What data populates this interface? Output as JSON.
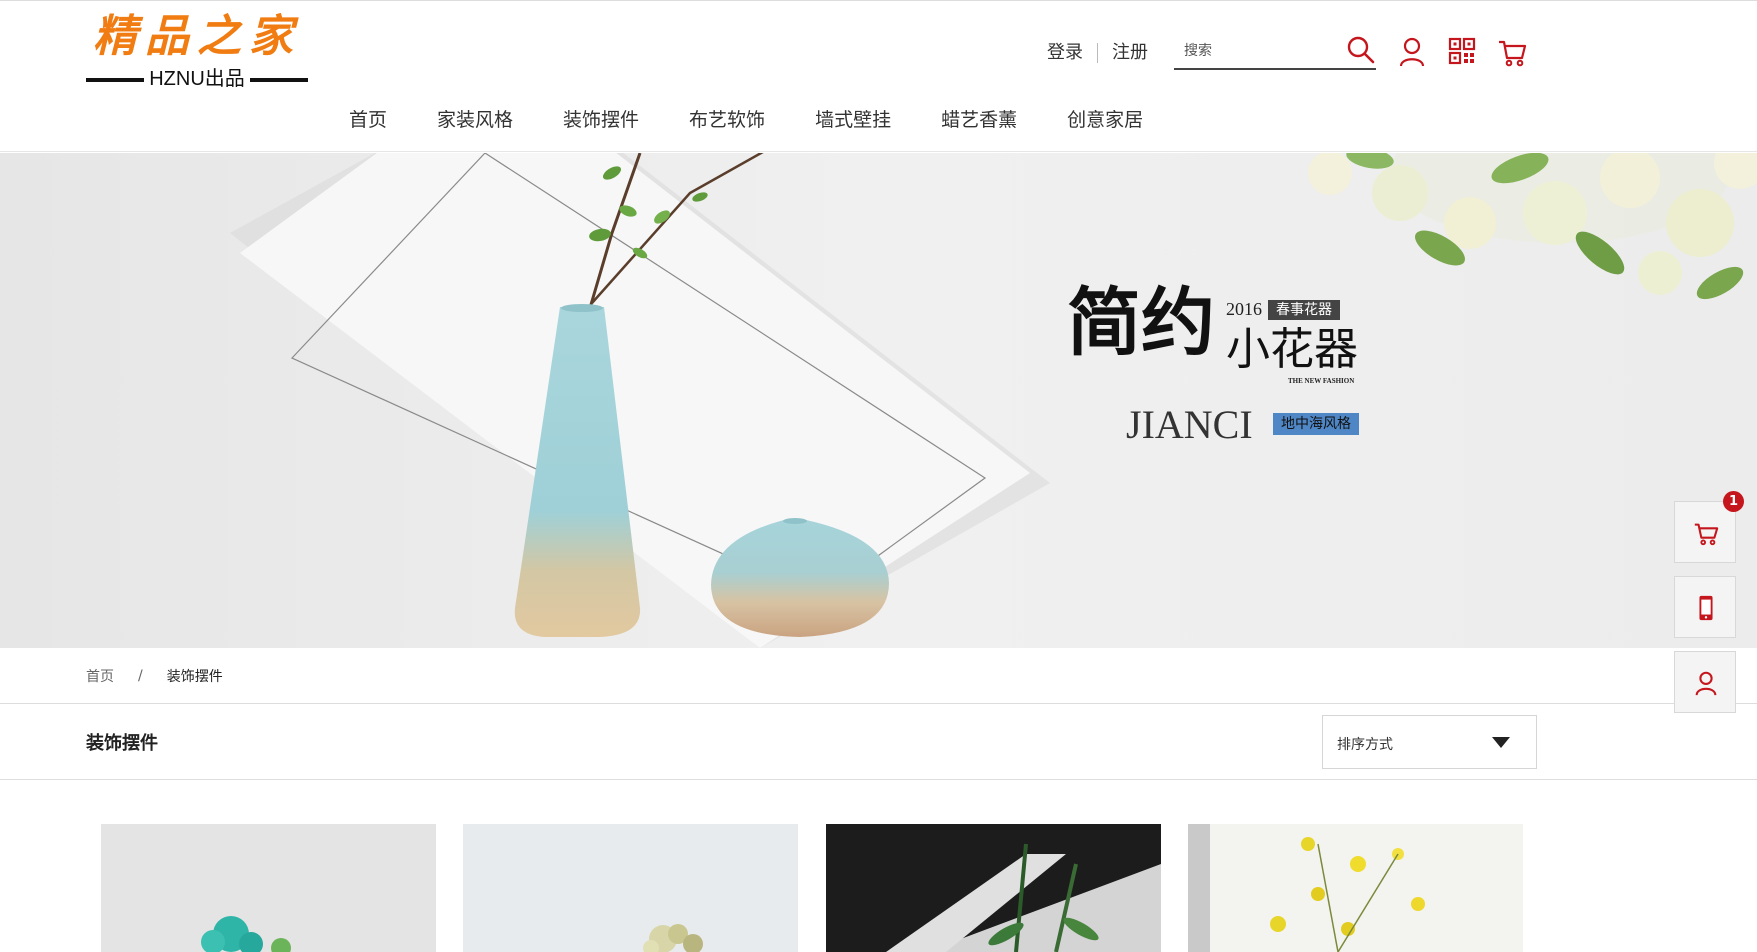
{
  "brand": {
    "title": "精品之家",
    "subtitle": "HZNU出品",
    "accent_color": "#f07c12",
    "icon_color": "#c4161c"
  },
  "header": {
    "login": "登录",
    "register": "注册",
    "search_placeholder": "搜索",
    "icons": [
      "search-icon",
      "user-icon",
      "qrcode-icon",
      "cart-icon"
    ]
  },
  "nav": {
    "items": [
      "首页",
      "家装风格",
      "装饰摆件",
      "布艺软饰",
      "墙式壁挂",
      "蜡艺香薰",
      "创意家居"
    ]
  },
  "banner": {
    "year": "2016",
    "tag": "春事花器",
    "headline_main": "简约",
    "headline_sub": "小花器",
    "fashion": "THE NEW FASHION",
    "brand_name": "JIANCI",
    "style_tag": "地中海风格"
  },
  "breadcrumb": {
    "home": "首页",
    "separator": "/",
    "current": "装饰摆件"
  },
  "section": {
    "title": "装饰摆件",
    "sort_label": "排序方式"
  },
  "side_tools": {
    "cart_count": "1",
    "icons": [
      "cart-icon",
      "mobile-icon",
      "user-icon"
    ]
  }
}
